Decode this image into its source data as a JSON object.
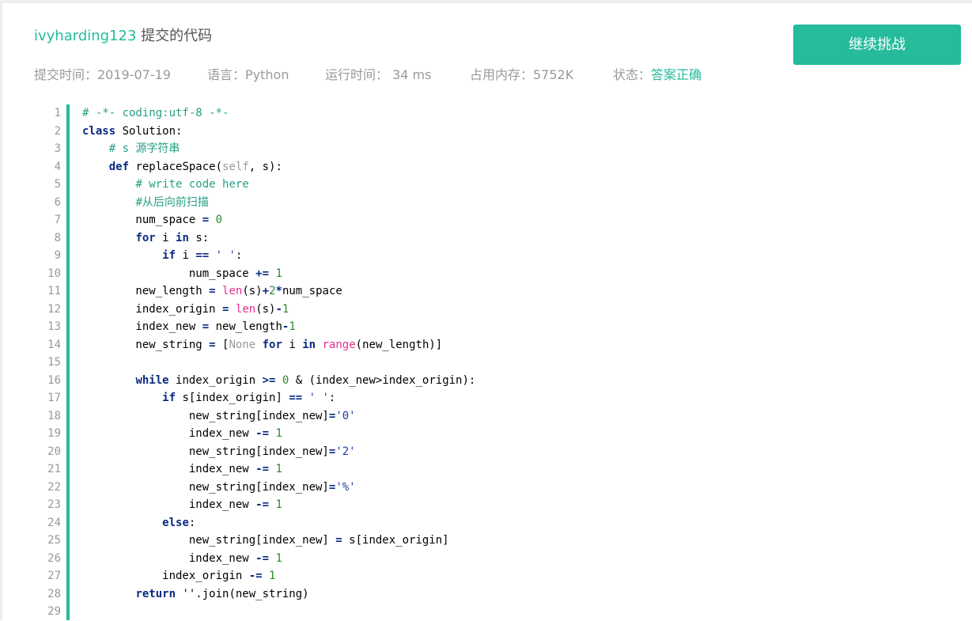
{
  "header": {
    "username": "ivyharding123",
    "title_suffix": " 提交的代码",
    "continue_button": "继续挑战"
  },
  "meta": {
    "submit_time": "提交时间：2019-07-19",
    "language": "语言：Python",
    "run_time": "运行时间： 34 ms",
    "memory": "占用内存：5752K",
    "status_label": "状态：",
    "status_value": "答案正确"
  },
  "code": {
    "lines": [
      [
        [
          "cm",
          "# -*- coding:utf-8 -*-"
        ]
      ],
      [
        [
          "kw",
          "class"
        ],
        [
          "plain",
          " Solution:"
        ]
      ],
      [
        [
          "plain",
          "    "
        ],
        [
          "cm",
          "# s 源字符串"
        ]
      ],
      [
        [
          "plain",
          "    "
        ],
        [
          "kw",
          "def"
        ],
        [
          "plain",
          " replaceSpace("
        ],
        [
          "self",
          "self"
        ],
        [
          "plain",
          ", s):"
        ]
      ],
      [
        [
          "plain",
          "        "
        ],
        [
          "cm",
          "# write code here"
        ]
      ],
      [
        [
          "plain",
          "        "
        ],
        [
          "cm",
          "#从后向前扫描"
        ]
      ],
      [
        [
          "plain",
          "        num_space "
        ],
        [
          "op",
          "="
        ],
        [
          "plain",
          " "
        ],
        [
          "num",
          "0"
        ]
      ],
      [
        [
          "plain",
          "        "
        ],
        [
          "kw",
          "for"
        ],
        [
          "plain",
          " i "
        ],
        [
          "kw",
          "in"
        ],
        [
          "plain",
          " s:"
        ]
      ],
      [
        [
          "plain",
          "            "
        ],
        [
          "kw",
          "if"
        ],
        [
          "plain",
          " i "
        ],
        [
          "op",
          "=="
        ],
        [
          "plain",
          " "
        ],
        [
          "str",
          "' '"
        ],
        [
          "plain",
          ":"
        ]
      ],
      [
        [
          "plain",
          "                num_space "
        ],
        [
          "op",
          "+="
        ],
        [
          "plain",
          " "
        ],
        [
          "num",
          "1"
        ]
      ],
      [
        [
          "plain",
          "        new_length "
        ],
        [
          "op",
          "="
        ],
        [
          "plain",
          " "
        ],
        [
          "bi",
          "len"
        ],
        [
          "plain",
          "(s)"
        ],
        [
          "op",
          "+"
        ],
        [
          "num",
          "2"
        ],
        [
          "op",
          "*"
        ],
        [
          "plain",
          "num_space"
        ]
      ],
      [
        [
          "plain",
          "        index_origin "
        ],
        [
          "op",
          "="
        ],
        [
          "plain",
          " "
        ],
        [
          "bi",
          "len"
        ],
        [
          "plain",
          "(s)"
        ],
        [
          "op",
          "-"
        ],
        [
          "num",
          "1"
        ]
      ],
      [
        [
          "plain",
          "        index_new "
        ],
        [
          "op",
          "="
        ],
        [
          "plain",
          " new_length"
        ],
        [
          "op",
          "-"
        ],
        [
          "num",
          "1"
        ]
      ],
      [
        [
          "plain",
          "        new_string "
        ],
        [
          "op",
          "="
        ],
        [
          "plain",
          " ["
        ],
        [
          "none",
          "None"
        ],
        [
          "plain",
          " "
        ],
        [
          "kw",
          "for"
        ],
        [
          "plain",
          " i "
        ],
        [
          "kw",
          "in"
        ],
        [
          "plain",
          " "
        ],
        [
          "bi",
          "range"
        ],
        [
          "plain",
          "(new_length)]"
        ]
      ],
      [],
      [
        [
          "plain",
          "        "
        ],
        [
          "kw",
          "while"
        ],
        [
          "plain",
          " index_origin "
        ],
        [
          "op",
          ">="
        ],
        [
          "plain",
          " "
        ],
        [
          "num",
          "0"
        ],
        [
          "plain",
          " & (index_new>index_origin):"
        ]
      ],
      [
        [
          "plain",
          "            "
        ],
        [
          "kw",
          "if"
        ],
        [
          "plain",
          " s[index_origin] "
        ],
        [
          "op",
          "=="
        ],
        [
          "plain",
          " "
        ],
        [
          "str",
          "' '"
        ],
        [
          "plain",
          ":"
        ]
      ],
      [
        [
          "plain",
          "                new_string[index_new]"
        ],
        [
          "op",
          "="
        ],
        [
          "str",
          "'0'"
        ]
      ],
      [
        [
          "plain",
          "                index_new "
        ],
        [
          "op",
          "-="
        ],
        [
          "plain",
          " "
        ],
        [
          "num",
          "1"
        ]
      ],
      [
        [
          "plain",
          "                new_string[index_new]"
        ],
        [
          "op",
          "="
        ],
        [
          "str",
          "'2'"
        ]
      ],
      [
        [
          "plain",
          "                index_new "
        ],
        [
          "op",
          "-="
        ],
        [
          "plain",
          " "
        ],
        [
          "num",
          "1"
        ]
      ],
      [
        [
          "plain",
          "                new_string[index_new]"
        ],
        [
          "op",
          "="
        ],
        [
          "str",
          "'%'"
        ]
      ],
      [
        [
          "plain",
          "                index_new "
        ],
        [
          "op",
          "-="
        ],
        [
          "plain",
          " "
        ],
        [
          "num",
          "1"
        ]
      ],
      [
        [
          "plain",
          "            "
        ],
        [
          "kw",
          "else"
        ],
        [
          "plain",
          ":"
        ]
      ],
      [
        [
          "plain",
          "                new_string[index_new] "
        ],
        [
          "op",
          "="
        ],
        [
          "plain",
          " s[index_origin]"
        ]
      ],
      [
        [
          "plain",
          "                index_new "
        ],
        [
          "op",
          "-="
        ],
        [
          "plain",
          " "
        ],
        [
          "num",
          "1"
        ]
      ],
      [
        [
          "plain",
          "            index_origin "
        ],
        [
          "op",
          "-="
        ],
        [
          "plain",
          " "
        ],
        [
          "num",
          "1"
        ]
      ],
      [
        [
          "plain",
          "        "
        ],
        [
          "kw",
          "return"
        ],
        [
          "plain",
          " ''.join(new_string)"
        ]
      ],
      []
    ]
  },
  "colors": {
    "accent": "#25bb9b"
  }
}
